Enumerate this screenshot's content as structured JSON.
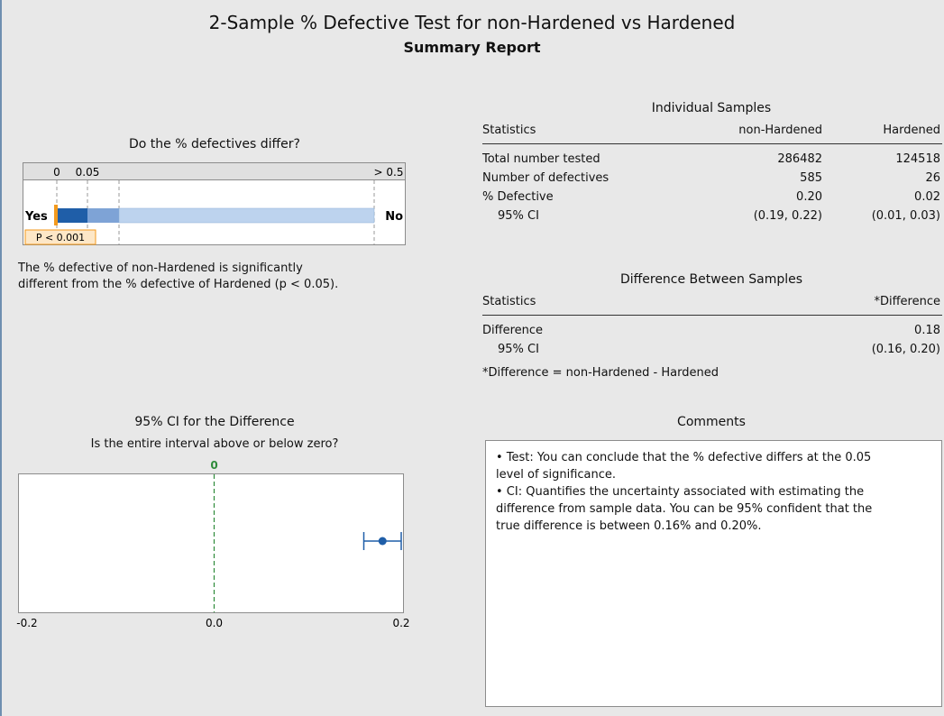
{
  "report": {
    "title": "2-Sample % Defective Test for non-Hardened vs Hardened",
    "subtitle": "Summary Report"
  },
  "test_panel": {
    "heading": "Do the % defectives differ?",
    "tick_0": "0",
    "tick_005": "0.05",
    "tick_05": "> 0.5",
    "yes_label": "Yes",
    "no_label": "No",
    "p_badge": "P < 0.001",
    "p_value_marker": 0.001,
    "conclusion_line1": "The % defective of non-Hardened is significantly",
    "conclusion_line2": "different from the % defective of Hardened (p < 0.05).",
    "colors": {
      "dark": "#1f5ea8",
      "mid": "#7ea3d6",
      "light": "#bdd3ee",
      "marker": "#f39a1e"
    }
  },
  "individual": {
    "heading": "Individual Samples",
    "col_stat": "Statistics",
    "col_a": "non-Hardened",
    "col_b": "Hardened",
    "rows": [
      {
        "label": "Total number tested",
        "a": "286482",
        "b": "124518"
      },
      {
        "label": "Number of defectives",
        "a": "585",
        "b": "26"
      },
      {
        "label": "% Defective",
        "a": "0.20",
        "b": "0.02"
      },
      {
        "label": "95% CI",
        "a": "(0.19, 0.22)",
        "b": "(0.01, 0.03)"
      }
    ]
  },
  "difference": {
    "heading": "Difference Between Samples",
    "col_stat": "Statistics",
    "col_diff": "*Difference",
    "rows": [
      {
        "label": "Difference",
        "value": "0.18"
      },
      {
        "label": "95% CI",
        "value": "(0.16, 0.20)"
      }
    ],
    "footnote": "*Difference = non-Hardened - Hardened"
  },
  "ci_panel": {
    "heading": "95% CI for the Difference",
    "question": "Is the entire interval above or below zero?",
    "zero_top_label": "0"
  },
  "comments": {
    "heading": "Comments",
    "lines": [
      "• Test: You can conclude that the % defective differs at the 0.05",
      "level of significance.",
      "• CI: Quantifies the uncertainty associated with estimating the",
      "difference from sample data. You can be 95% confident that the",
      "true difference is between 0.16% and 0.20%."
    ]
  },
  "chart_data": [
    {
      "type": "scatter",
      "title": "95% CI for the Difference",
      "subtitle": "Is the entire interval above or below zero?",
      "x_ticks": [
        "-0.2",
        "0.0",
        "0.2"
      ],
      "xlim": [
        -0.2,
        0.2
      ],
      "reference_line": 0,
      "points": [
        {
          "x": 0.18,
          "ci_low": 0.16,
          "ci_high": 0.2
        }
      ],
      "colors": {
        "point": "#1f5ea8",
        "reference": "#2e8b3a"
      }
    }
  ]
}
